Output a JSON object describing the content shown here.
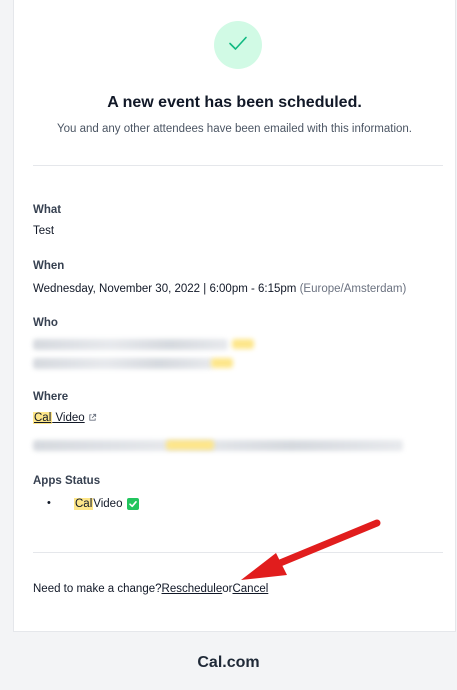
{
  "header": {
    "title": "A new event has been scheduled.",
    "subtitle": "You and any other attendees have been emailed with this information.",
    "check_icon": "check-icon"
  },
  "details": {
    "what": {
      "label": "What",
      "value": "Test"
    },
    "when": {
      "label": "When",
      "value": "Wednesday, November 30, 2022 | 6:00pm - 6:15pm",
      "timezone": "(Europe/Amsterdam)"
    },
    "who": {
      "label": "Who"
    },
    "where": {
      "label": "Where",
      "location_brand": "Cal",
      "location_rest": " Video",
      "external_icon": "external-link-icon"
    },
    "apps_status": {
      "label": "Apps Status",
      "item_brand": "Cal",
      "item_rest": " Video",
      "status_icon": "white-check-mark-icon"
    }
  },
  "footer": {
    "prompt": "Need to make a change?",
    "reschedule": "Reschedule",
    "or": "or",
    "cancel": "Cancel"
  },
  "brand": {
    "name": "Cal.com"
  },
  "colors": {
    "success_bg": "#d1fae5",
    "success_check": "#10b981",
    "highlight": "#fde68a",
    "annotation_arrow": "#e11d1d"
  }
}
